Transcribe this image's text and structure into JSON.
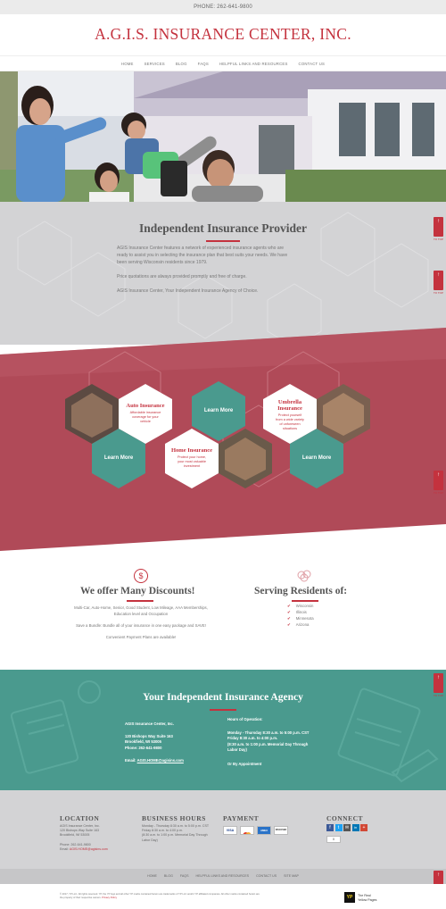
{
  "topbar": {
    "phone": "PHONE: 262-641-9800"
  },
  "header": {
    "title": "A.G.I.S. INSURANCE CENTER, INC."
  },
  "nav": [
    "HOME",
    "SERVICES",
    "BLOG",
    "FAQS",
    "HELPFUL LINKS AND RESOURCES",
    "CONTACT US"
  ],
  "intro": {
    "title": "Independent Insurance Provider",
    "p1": "AGIS Insurance Center features a network of experienced insurance agents who are",
    "p1b": "ready to assist you in selecting the insurance plan that best suits your needs. We have",
    "p1c": "been serving Wisconsin residents since 1979.",
    "p2": "Price quotations are always provided promptly and free of charge.",
    "p3": "AGIS Insurance Center, Your Independent Insurance Agency of Choice."
  },
  "side_tab": {
    "arrow": "↑",
    "label": "BACK TO TOP"
  },
  "services": {
    "auto": {
      "title": "Auto Insurance",
      "desc1": "Affordable insurance",
      "desc2": "coverage for your",
      "desc3": "vehicle"
    },
    "home": {
      "title": "Home Insurance",
      "desc1": "Protect your home,",
      "desc2": "your most valuable",
      "desc3": "investment"
    },
    "umbrella": {
      "title1": "Umbrella",
      "title2": "Insurance",
      "desc1": "Protect yourself",
      "desc2": "from a wide variety",
      "desc3": "of unforeseen",
      "desc4": "situations"
    },
    "learn_more": "Learn More"
  },
  "discounts": {
    "icon_symbol": "$",
    "title": "We offer Many Discounts!",
    "line1": "Multi-Car, Auto-Home, Senior, Good Student, Low Mileage, AAA Memberships,",
    "line2": "Education level and Occupation",
    "line3": "Save a Bundle: Bundle all of your insurance in one easy package and SAVE!",
    "line4": "Convenient Payment Plans are available!"
  },
  "serving": {
    "title": "Serving Residents of:",
    "states": [
      "Wisconsin",
      "Illinois",
      "Minnesota",
      "Arizona"
    ]
  },
  "agency": {
    "title": "Your Independent Insurance Agency",
    "name": "AGIS Insurance Center, Inc.",
    "address1": "120 Bishops Way Suite 163",
    "address2": "Brookfield, WI 53005",
    "phone": "Phone: 262-641-9800",
    "email_label": "Email:",
    "email": "AGIS.HOME@agisins.com",
    "hours_title": "Hours of Operation:",
    "hours1": "Monday - Thursday 8:30 a.m. to 5:00 p.m. CST",
    "hours2": "Friday 8:30 a.m. to 4:00 p.m.",
    "hours3": "(8:30 a.m. to 1:00 p.m. Memorial Day Through",
    "hours4": "Labor Day)",
    "hours5": "Or By Appointment"
  },
  "footer": {
    "location_title": "LOCATION",
    "loc1": "AGIS Insurance Center, Inc.",
    "loc2": "120 Bishops Way Suite 163",
    "loc3": "Brookfield, WI 53005",
    "loc4": "Phone: 262-641-9800",
    "loc5_label": "Email:",
    "loc5": "AGIS.HOME@agisins.com",
    "hours_title": "BUSINESS HOURS",
    "bh1": "Monday - Thursday 8:30 a.m. to 5:00 p.m. CST",
    "bh2": "Friday 8:30 a.m. to 4:00 p.m.",
    "bh3": "(8:30 a.m. to 1:00 p.m. Memorial Day Through",
    "bh4": "Labor Day)",
    "payment_title": "PAYMENT",
    "cards": [
      "VISA",
      "MC",
      "AMEX",
      "DISCOVER"
    ],
    "connect_title": "CONNECT",
    "social": [
      "f",
      "t",
      "✉",
      "in",
      "+"
    ],
    "counter": "0"
  },
  "bottomnav": [
    "HOME",
    "BLOG",
    "FAQS",
    "HELPFUL LINKS AND RESOURCES",
    "CONTACT US",
    "SITE MAP"
  ],
  "legal": {
    "line1": "© 2017, YP LLC. All rights reserved. YP, the YP logo and all other YP marks contained herein are trademarks of YP LLC and/or YP affiliated companies. All other marks contained herein are",
    "line2": "the property of their respective owners.",
    "privacy": "Privacy Policy",
    "yp_logo": "YP",
    "yp_text1": "The Real",
    "yp_text2": "Yellow Pages"
  },
  "colors": {
    "brand_red": "#c4323e",
    "teal": "#4a9a8e",
    "maroon": "#b04a58"
  }
}
